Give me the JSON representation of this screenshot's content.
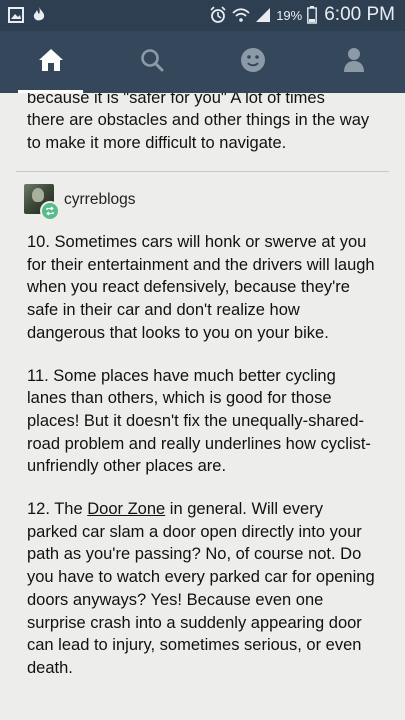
{
  "status_bar": {
    "battery_percent": "19%",
    "time": "6:00 PM",
    "icons": [
      "image-icon",
      "flame-icon",
      "alarm-icon",
      "wifi-icon",
      "signal-icon",
      "battery-icon"
    ]
  },
  "nav": {
    "tabs": [
      {
        "name": "home",
        "icon": "home-icon",
        "active": true
      },
      {
        "name": "search",
        "icon": "search-icon",
        "active": false
      },
      {
        "name": "activity",
        "icon": "smiley-icon",
        "active": false
      },
      {
        "name": "account",
        "icon": "person-icon",
        "active": false
      }
    ]
  },
  "post": {
    "previous_cut_line": "because it is \"safer for you\" A lot of times",
    "previous_tail": "there are obstacles and other things in the way to make it more difficult to navigate.",
    "reblogger": "cyrreblogs",
    "item10": "10. Sometimes cars will honk or swerve at you for their entertainment and the drivers will laugh when you react defensively, because they're safe in their car and don't realize how dangerous that looks to you on your bike.",
    "item11": "11. Some places have much better cycling lanes than others, which is good for those places! But it doesn't fix the unequally-shared-road problem and really underlines how cyclist-unfriendly other places are.",
    "item12": {
      "prefix": "12. The ",
      "link": "Door Zone",
      "rest": " in general. Will every parked car slam a door open directly into your path as you're passing? No, of course not. Do you have to watch every parked car for opening doors anyways? Yes! Because even one surprise crash into a suddenly appearing door can lead to injury, sometimes serious, or even death."
    }
  },
  "colors": {
    "status_bar": "#2e3f52",
    "nav_bar": "#34475b",
    "background": "#ededeb",
    "reblog_green": "#56bc8a"
  }
}
